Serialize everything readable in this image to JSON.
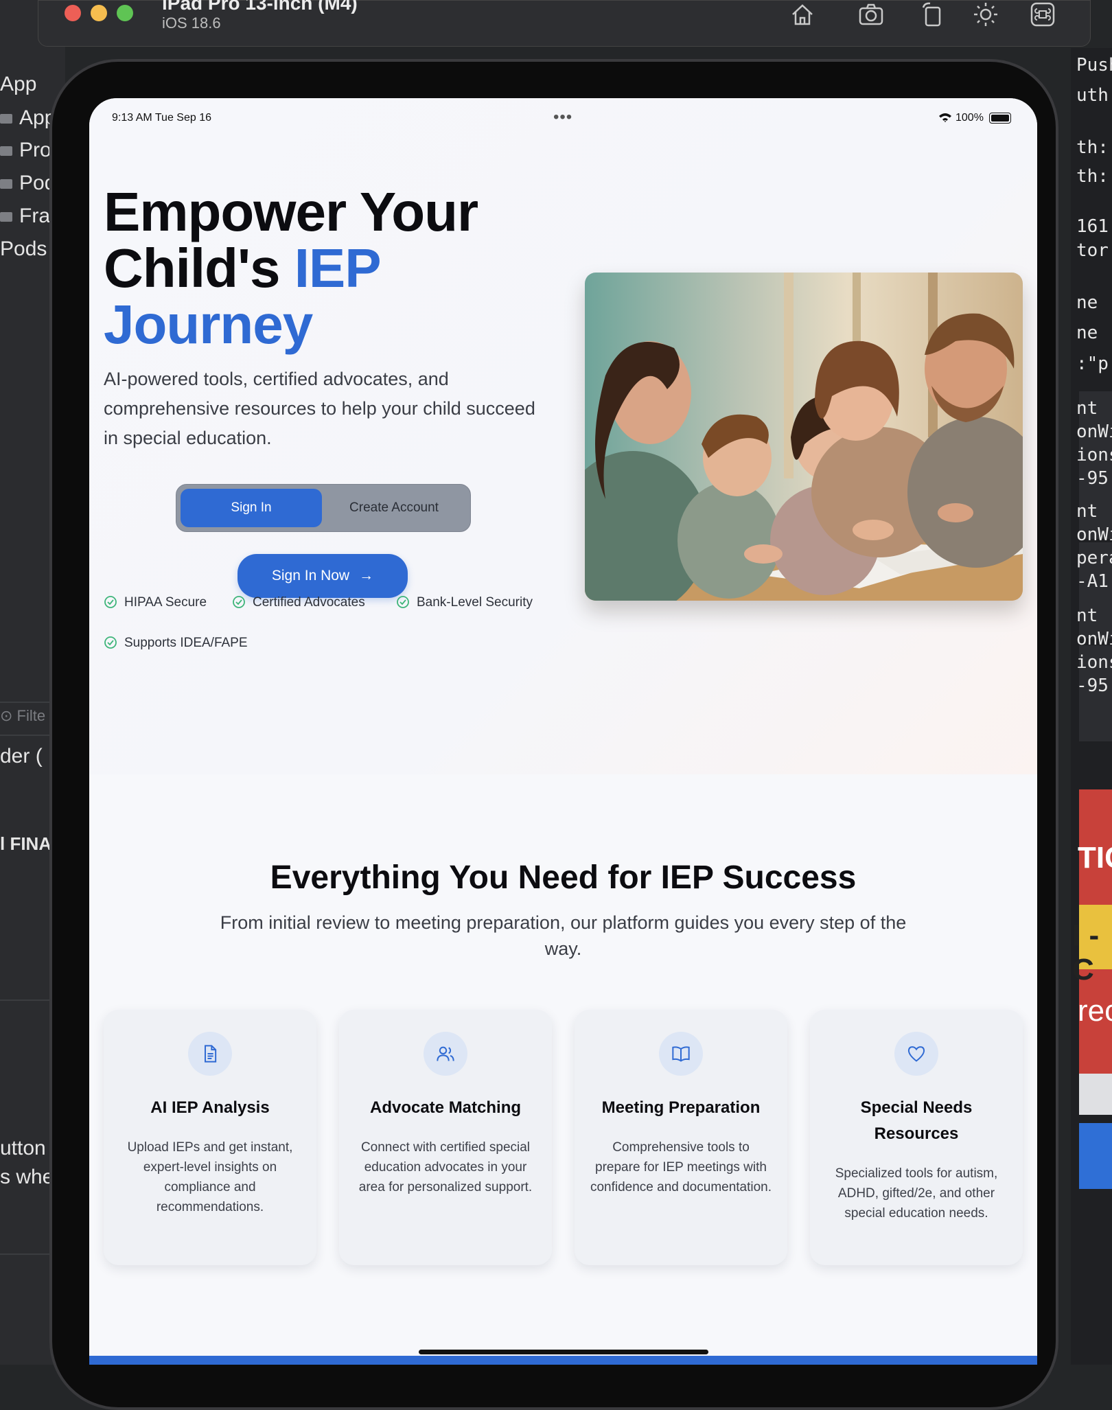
{
  "xcode": {
    "left_items": [
      "App",
      "App",
      "Pro",
      "Pod",
      "Fra",
      "Pods"
    ],
    "filter_label": "Filte",
    "partial_labels": [
      "der (",
      "l FINA",
      "utton",
      "s whe"
    ],
    "right_code": [
      "PushN",
      "uth:",
      "th:",
      "th:",
      "161",
      "tor",
      "ne",
      "ne",
      ":\"p",
      "nt",
      "onWi",
      "ions",
      "-95",
      "nt",
      "onWi",
      "pera",
      "-A1",
      "nt",
      "onWi",
      "ions",
      "-95"
    ],
    "right_labels": [
      "TIC",
      "I - C",
      "rec"
    ]
  },
  "simulator": {
    "title": "iPad Pro 13-inch (M4)",
    "subtitle": "iOS 18.6",
    "toolbar_icons": [
      "home-icon",
      "camera-icon",
      "rotate-icon",
      "brightness-icon",
      "command-icon"
    ]
  },
  "status_bar": {
    "time": "9:13 AM   Tue Sep 16",
    "battery": "100%"
  },
  "hero": {
    "headline_part1": "Empower Your Child's ",
    "headline_accent": "IEP Journey",
    "subtitle": "AI-powered tools, certified advocates, and comprehensive resources to help your child succeed in special education.",
    "segment": {
      "selected": "Sign In",
      "other": "Create Account"
    },
    "cta": "Sign In Now",
    "badges": [
      "HIPAA Secure",
      "Certified Advocates",
      "Bank-Level Security",
      "Supports IDEA/FAPE"
    ]
  },
  "features": {
    "title": "Everything You Need for IEP Success",
    "subtitle": "From initial review to meeting preparation, our platform guides you every step of the way.",
    "cards": [
      {
        "icon": "document-icon",
        "title": "AI IEP Analysis",
        "body": "Upload IEPs and get instant, expert-level insights on compliance and recommendations."
      },
      {
        "icon": "users-icon",
        "title": "Advocate Matching",
        "body": "Connect with certified special education advocates in your area for personalized support."
      },
      {
        "icon": "book-icon",
        "title": "Meeting Preparation",
        "body": "Comprehensive tools to prepare for IEP meetings with confidence and documentation."
      },
      {
        "icon": "heart-icon",
        "title": "Special Needs Resources",
        "body": "Specialized tools for autism, ADHD, gifted/2e, and other special education needs."
      }
    ]
  },
  "colors": {
    "accent": "#2f6ad3",
    "check": "#3fb57a"
  }
}
